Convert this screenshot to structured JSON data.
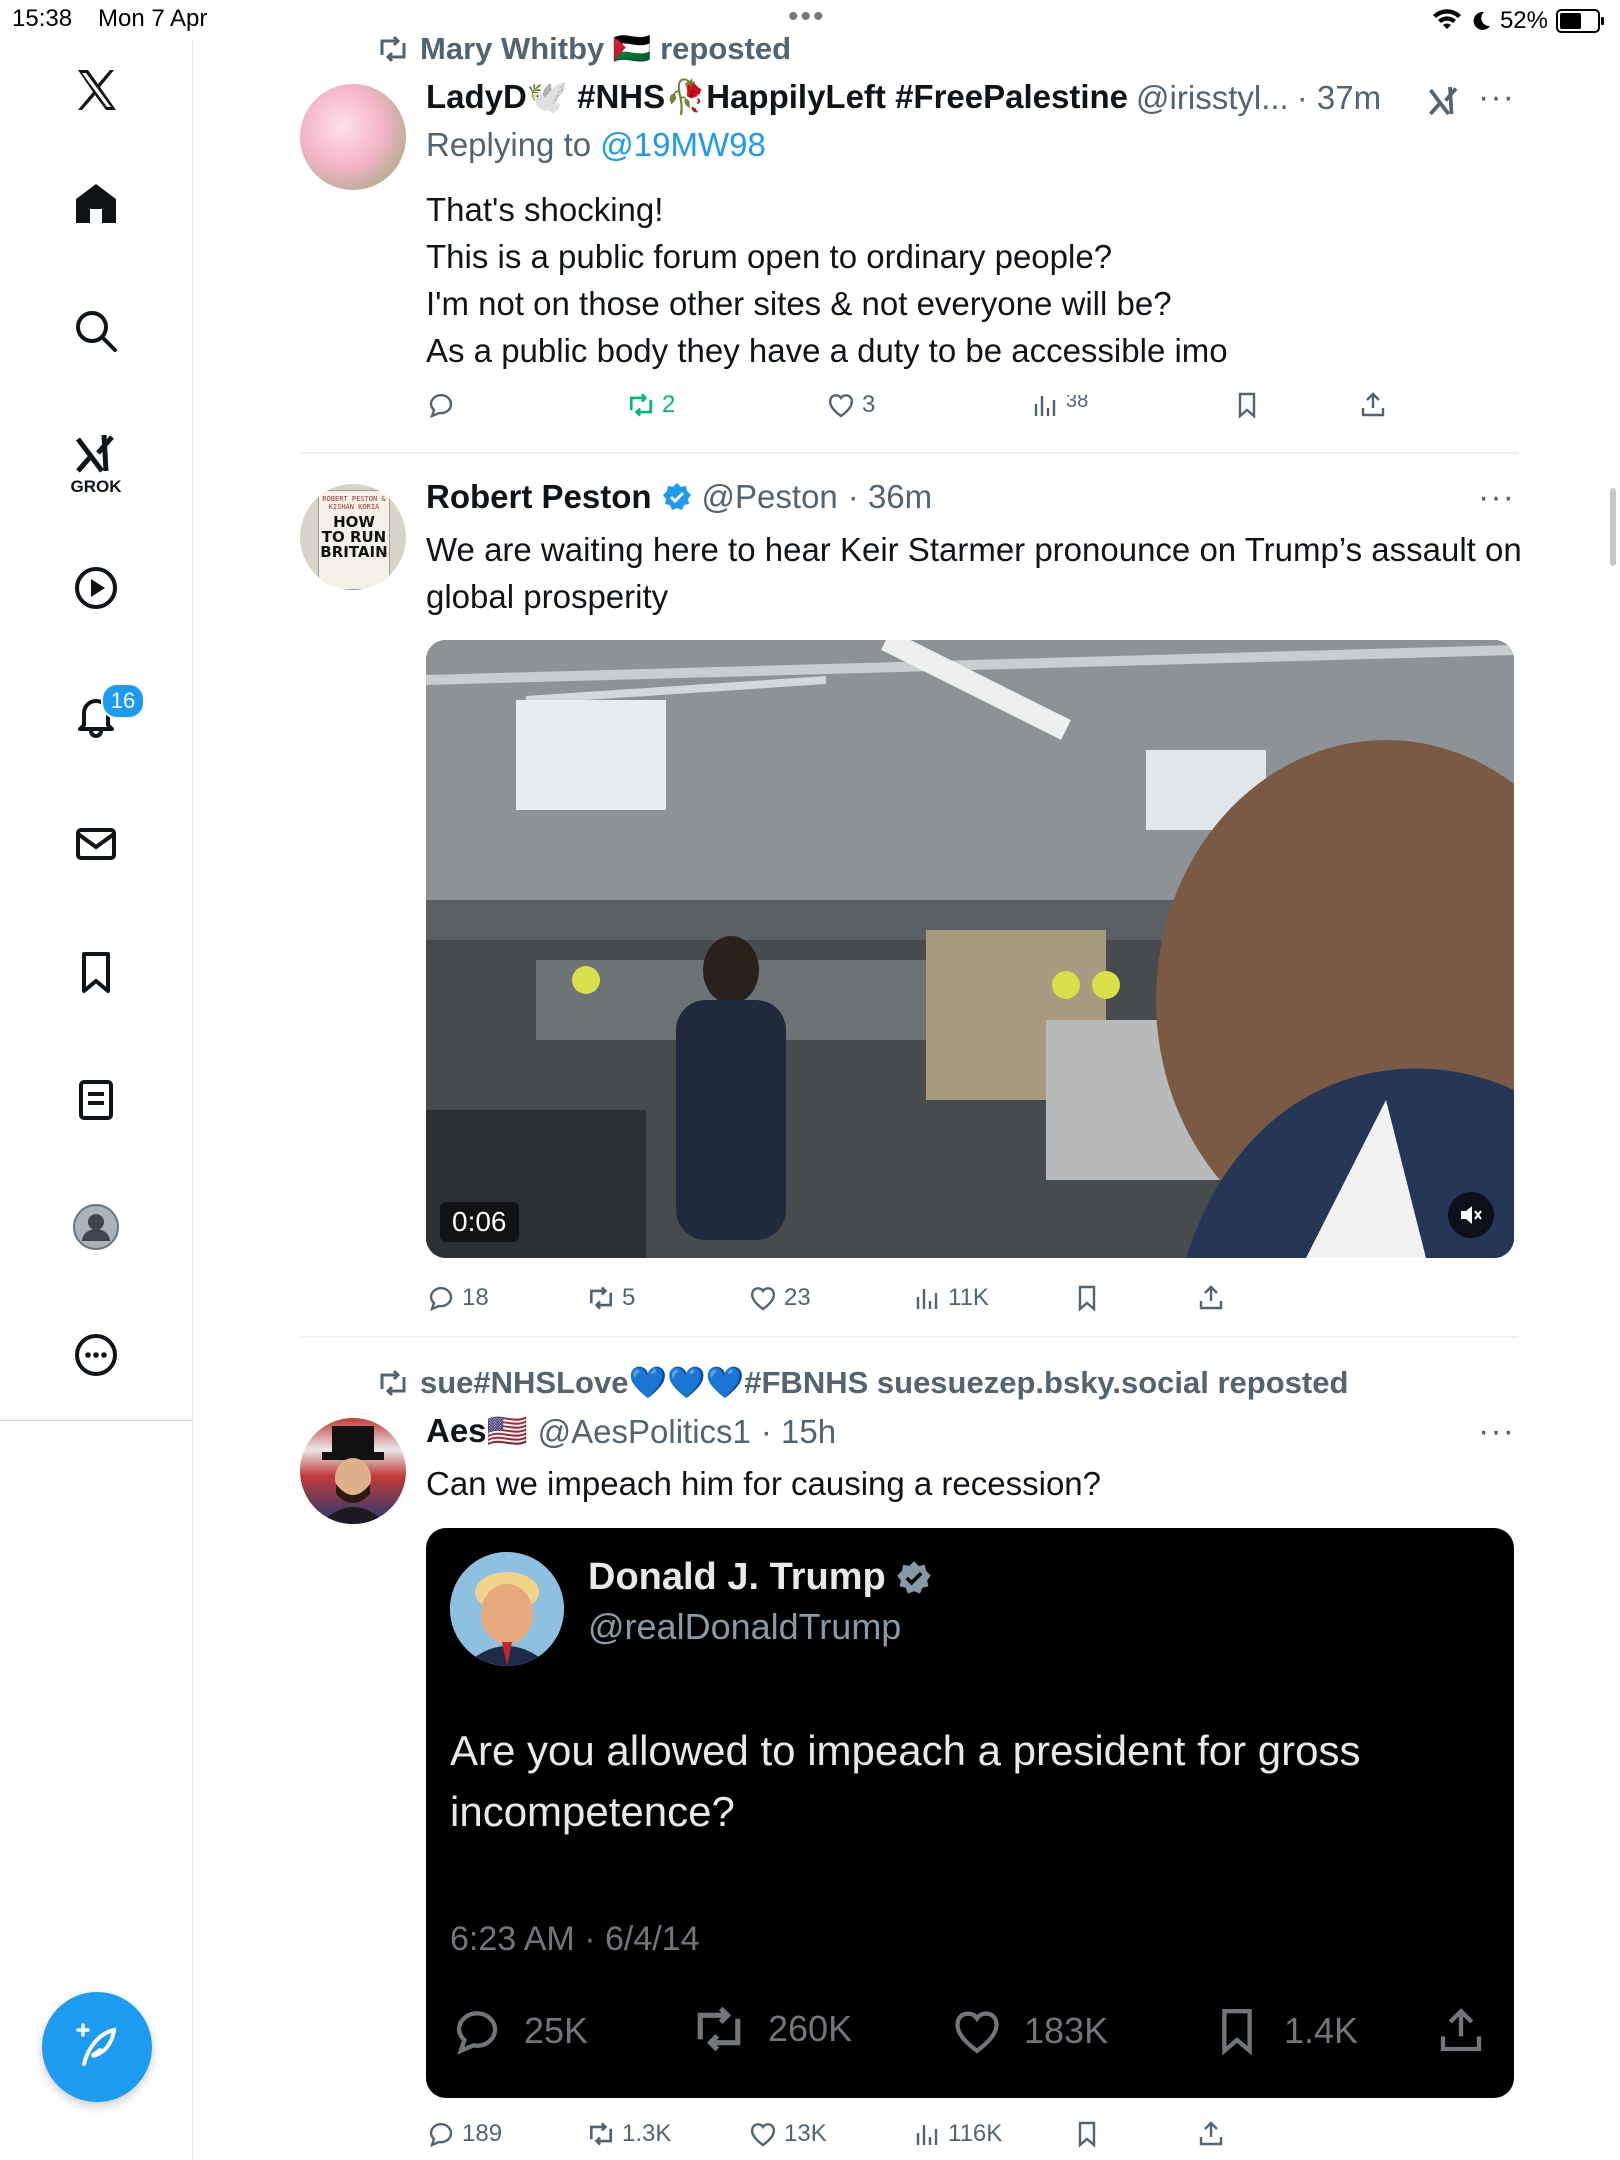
{
  "status_bar": {
    "time": "15:38",
    "date": "Mon 7 Apr",
    "battery": "52%"
  },
  "sidebar": {
    "grok_label": "GROK",
    "notification_count": "16"
  },
  "colors": {
    "accent": "#1d9bf0",
    "repost_green": "#00ba7c",
    "text_secondary": "#536471"
  },
  "posts": [
    {
      "repost_by": "Mary Whitby 🇵🇸 reposted",
      "name": "LadyD🕊️ #NHS🥀HappilyLeft #FreePalestine",
      "handle": "@irisstyl...",
      "time": "· 37m",
      "replying_label": "Replying to",
      "replying_to": "@19MW98",
      "lines": [
        "That's shocking!",
        "This is a public forum open to ordinary people?",
        "I'm not on those other sites & not everyone will be?",
        "As a public body they have a duty to be accessible imo"
      ],
      "replies": "",
      "reposts": "2",
      "likes": "3",
      "views": "38"
    },
    {
      "name": "Robert Peston",
      "handle": "@Peston",
      "time": "· 36m",
      "text": "We are waiting here to hear Keir Starmer pronounce on Trump’s assault on global prosperity",
      "video_duration": "0:06",
      "replies": "18",
      "reposts": "5",
      "likes": "23",
      "views": "11K",
      "avatar_book": {
        "top": "ROBERT PESTON & KISHAN KORIA",
        "title": "HOW TO RUN BRITAIN"
      }
    },
    {
      "repost_by": "sue#NHSLove💙💙💙#FBNHS suesuezep.bsky.social reposted",
      "name": "Aes🇺🇸",
      "handle": "@AesPolitics1",
      "time": "· 15h",
      "text": "Can we impeach him for causing a recession?",
      "quote": {
        "name": "Donald J. Trump",
        "handle": "@realDonaldTrump",
        "text": "Are you allowed to impeach a president for gross incompetence?",
        "timestamp": "6:23 AM · 6/4/14",
        "replies": "25K",
        "reposts": "260K",
        "likes": "183K",
        "bookmarks": "1.4K"
      },
      "replies": "189",
      "reposts": "1.3K",
      "likes": "13K",
      "views": "116K"
    }
  ]
}
